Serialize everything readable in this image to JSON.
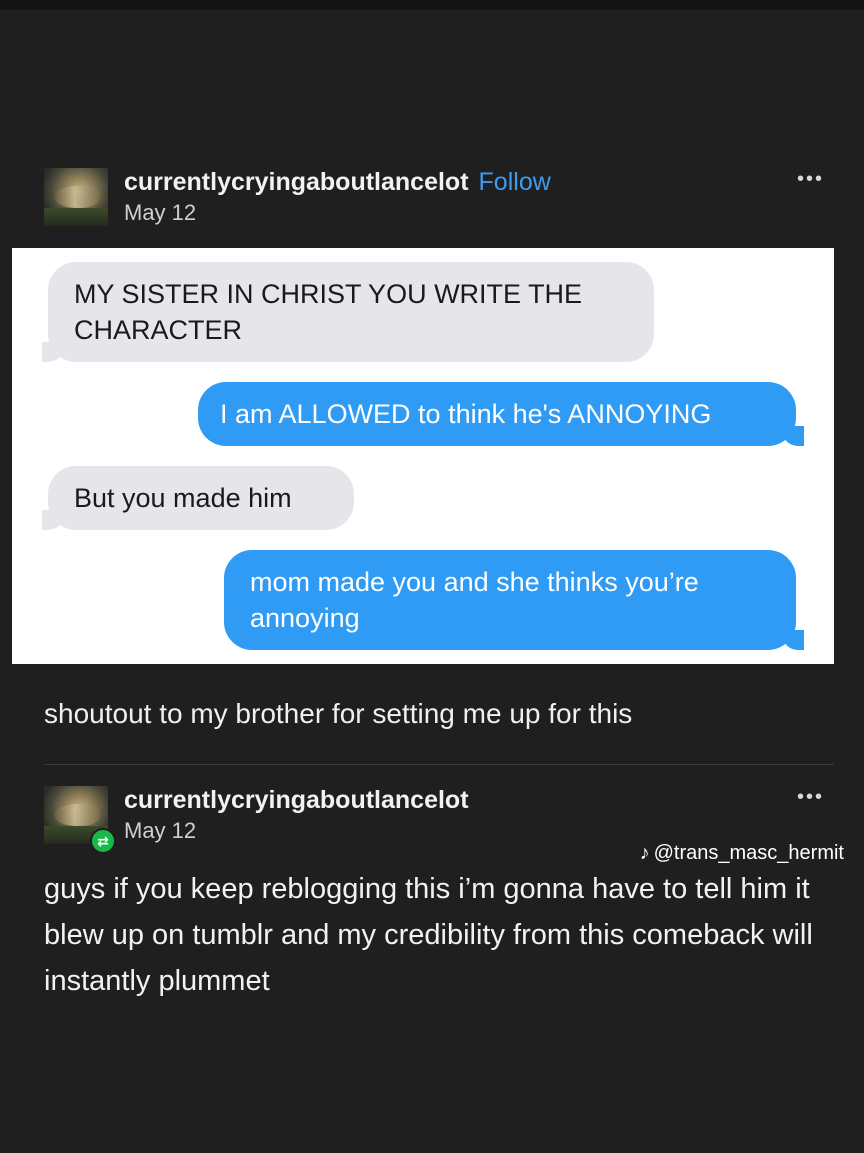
{
  "post": {
    "username": "currentlycryingaboutlancelot",
    "follow_label": "Follow",
    "date": "May 12",
    "more_label": "•••",
    "messages": [
      {
        "side": "in",
        "text": "MY SISTER IN CHRIST YOU WRITE THE CHARACTER"
      },
      {
        "side": "out",
        "text": "I am ALLOWED to think he's ANNOYING"
      },
      {
        "side": "in",
        "text": "But you made him"
      },
      {
        "side": "out",
        "text": "mom made you and she thinks you’re annoying"
      }
    ],
    "caption": "shoutout to my brother for setting me up for this"
  },
  "reblog": {
    "username": "currentlycryingaboutlancelot",
    "date": "May 12",
    "more_label": "•••",
    "text": "guys if you keep reblogging this i’m gonna have to tell him it blew up on tumblr and my credibility from this comeback will instantly plummet"
  },
  "watermark": {
    "icon": "tiktok-icon",
    "handle": "@trans_masc_hermit"
  },
  "colors": {
    "background": "#1f1f1f",
    "link_blue": "#3d9bf0",
    "bubble_out": "#2f9bf4",
    "bubble_in": "#e6e6ea",
    "reblog_green": "#1ab84a"
  }
}
